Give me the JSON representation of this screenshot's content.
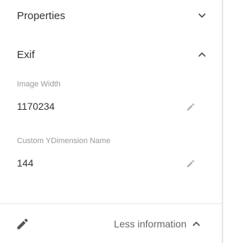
{
  "sections": {
    "properties": {
      "title": "Properties",
      "icon": "chevron-down-icon",
      "expanded": false
    },
    "exif": {
      "title": "Exif",
      "icon": "chevron-up-icon",
      "expanded": true
    }
  },
  "fields": [
    {
      "label": "Image Width",
      "value": "1170234",
      "icon": "edit-icon"
    },
    {
      "label": "Custom YDimension Name",
      "value": "144",
      "icon": "edit-icon"
    }
  ],
  "footer": {
    "edit_icon": "pencil-icon",
    "toggle_label": "Less information",
    "toggle_icon": "chevron-up-icon"
  },
  "colors": {
    "text": "#333333",
    "label": "#9a9a9a",
    "icon": "#555555",
    "icon_muted": "#b0b0b0",
    "divider": "#e6e6e6"
  }
}
